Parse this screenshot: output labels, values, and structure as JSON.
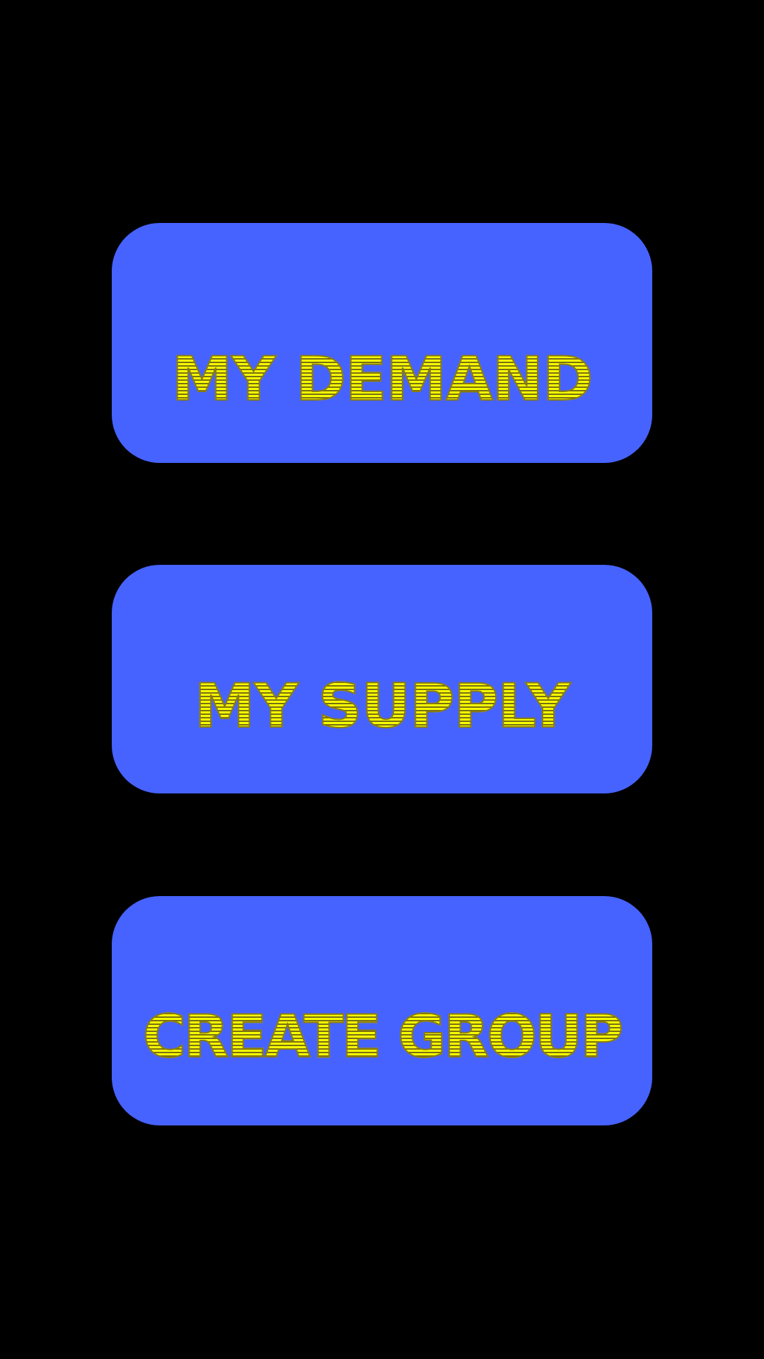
{
  "menu": {
    "buttons": [
      {
        "label": "MY DEMAND"
      },
      {
        "label": "MY SUPPLY"
      },
      {
        "label": "CREATE GROUP"
      }
    ]
  },
  "colors": {
    "background": "#000000",
    "button": "#4663ff",
    "label": "#f6ff00"
  }
}
